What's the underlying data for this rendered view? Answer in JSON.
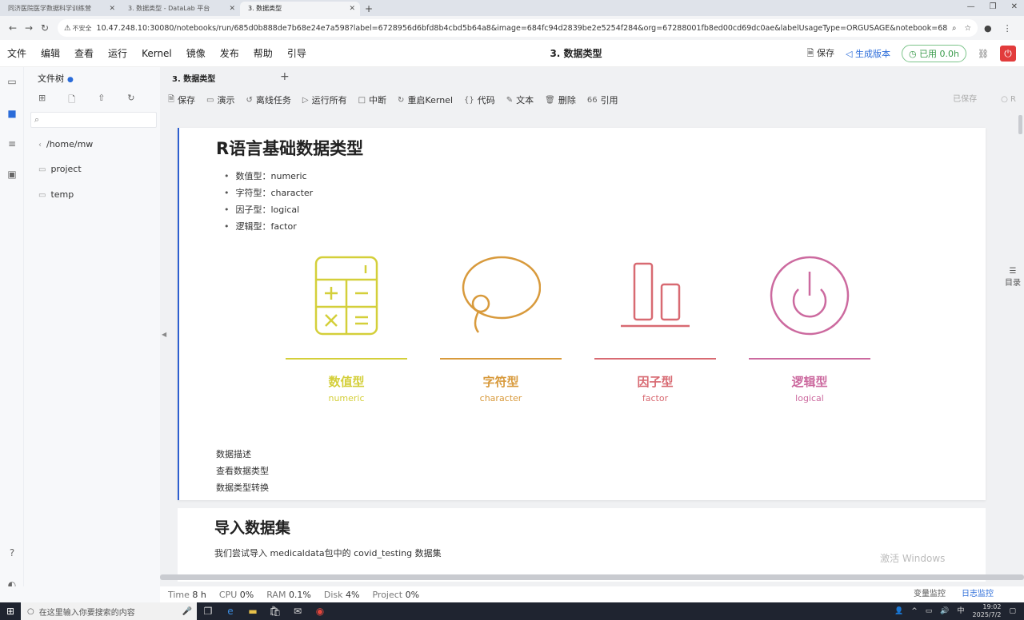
{
  "browser": {
    "tabs": [
      {
        "label": "同济医院医学数据科学训练营",
        "active": false
      },
      {
        "label": "3. 数据类型 - DataLab 平台",
        "active": false
      },
      {
        "label": "3. 数据类型",
        "active": true
      }
    ],
    "insecure_label": "不安全",
    "url": "10.47.248.10:30080/notebooks/run/685d0b888de7b68e24e7a598?label=6728956d6bfd8b4cbd5b64a8&image=684fc94d2839be2e5254f284&org=67288001fb8ed00cd69dc0ae&labelUsageType=ORGUSAGE&notebook=685d0baf8de7b68e24e7a..."
  },
  "menubar": {
    "items": [
      "文件",
      "编辑",
      "查看",
      "运行",
      "Kernel",
      "镜像",
      "发布",
      "帮助",
      "引导"
    ],
    "doc_title": "3. 数据类型",
    "save_label": "保存",
    "publish_label": "生成版本",
    "usage_label": "已用 0.0h"
  },
  "filetree": {
    "title": "文件树",
    "search_placeholder": "",
    "path": "/home/mw",
    "items": [
      "project",
      "temp"
    ]
  },
  "notebook": {
    "tab_label": "3. 数据类型",
    "toolbar": [
      "保存",
      "演示",
      "离线任务",
      "运行所有",
      "中断",
      "重启Kernel",
      "代码",
      "文本",
      "删除",
      "引用"
    ],
    "saved_label": "已保存",
    "kernel_label": "R",
    "toc_label": "目录"
  },
  "cell1": {
    "title": "R语言基础数据类型",
    "bullets": [
      "数值型：numeric",
      "字符型：character",
      "因子型：logical",
      "逻辑型：factor"
    ],
    "categories": [
      {
        "zh": "数值型",
        "en": "numeric",
        "color": "#d4cf3a"
      },
      {
        "zh": "字符型",
        "en": "character",
        "color": "#d89a3c"
      },
      {
        "zh": "因子型",
        "en": "factor",
        "color": "#d86a72"
      },
      {
        "zh": "逻辑型",
        "en": "logical",
        "color": "#cc6a9f"
      }
    ],
    "links": [
      "数据描述",
      "查看数据类型",
      "数据类型转换"
    ]
  },
  "cell2": {
    "title": "导入数据集",
    "text": "我们尝试导入 medicaldata包中的 covid_testing 数据集"
  },
  "statusbar": {
    "time_label": "Time",
    "time_value": "8 h",
    "cpu_label": "CPU",
    "cpu_value": "0%",
    "ram_label": "RAM",
    "ram_value": "0.1%",
    "disk_label": "Disk",
    "disk_value": "4%",
    "project_label": "Project",
    "project_value": "0%",
    "monitor_label": "变量监控",
    "log_label": "日志监控"
  },
  "windows_watermark": "激活 Windows",
  "taskbar": {
    "search_placeholder": "在这里输入你要搜索的内容",
    "ime": "中",
    "time": "19:02",
    "date": "2025/7/2"
  }
}
